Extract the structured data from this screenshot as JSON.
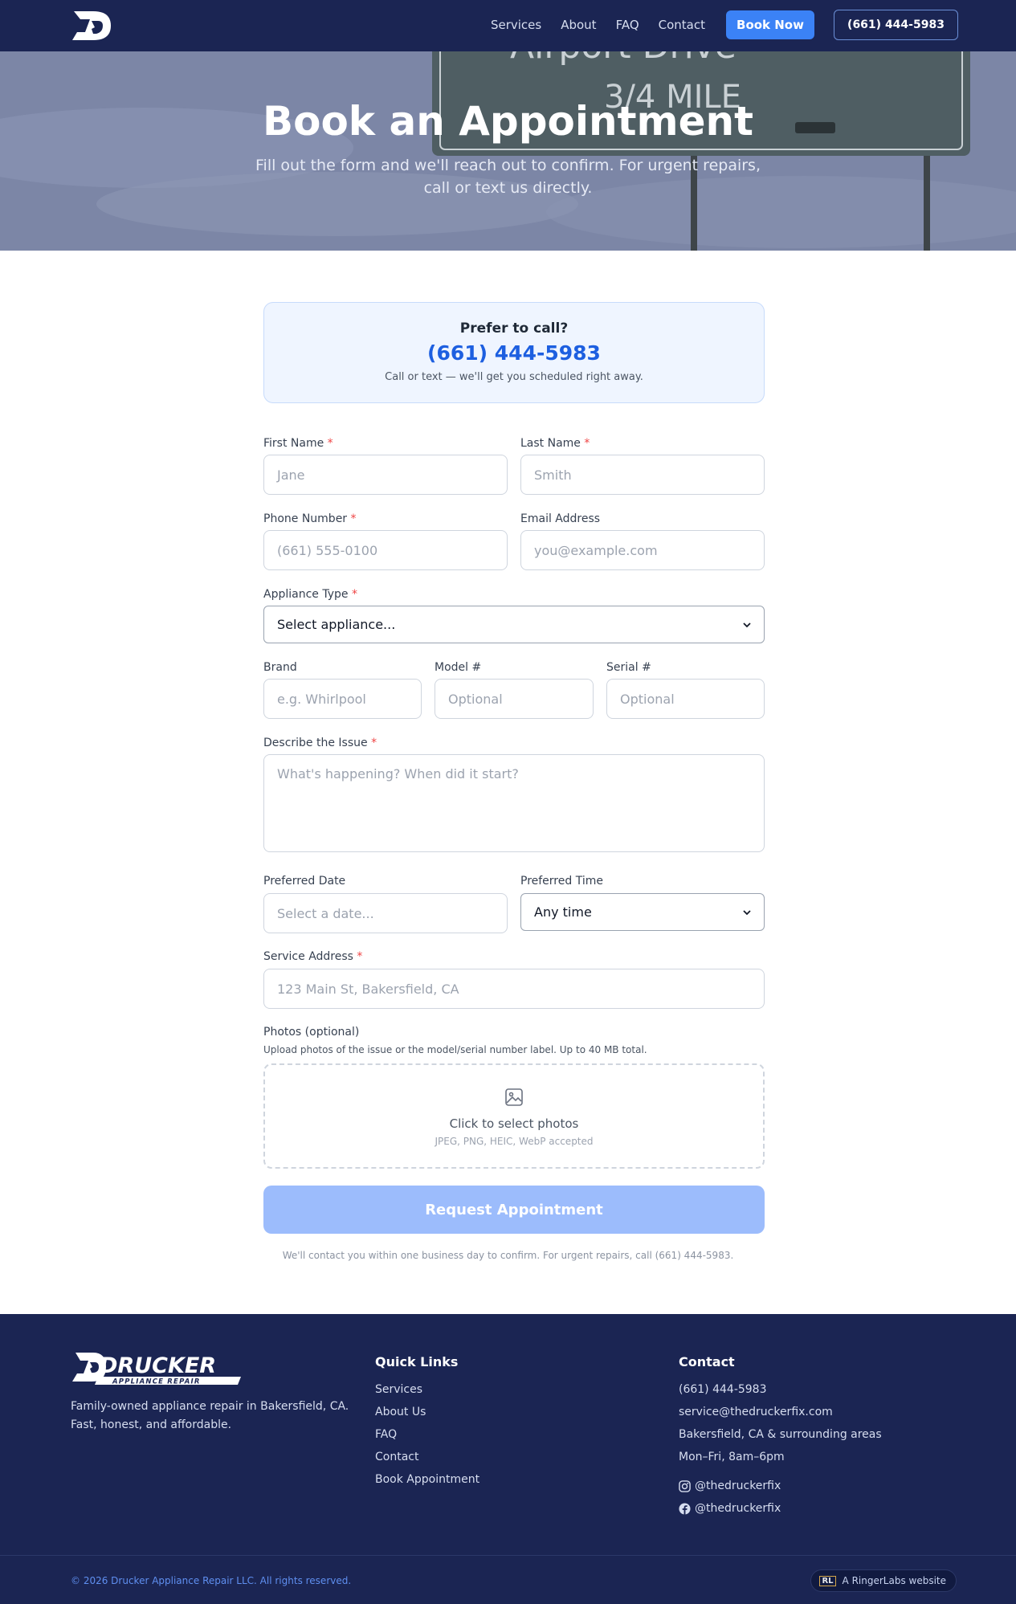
{
  "nav": {
    "links": [
      "Services",
      "About",
      "FAQ",
      "Contact"
    ],
    "book_label": "Book Now",
    "phone_label": "(661) 444-5983"
  },
  "hero": {
    "title": "Book an Appointment",
    "subtitle": "Fill out the form and we'll reach out to confirm. For urgent repairs, call or text us directly."
  },
  "callbox": {
    "title": "Prefer to call?",
    "phone": "(661) 444-5983",
    "note": "Call or text — we'll get you scheduled right away."
  },
  "form": {
    "first_name": {
      "label": "First Name",
      "placeholder": "Jane"
    },
    "last_name": {
      "label": "Last Name",
      "placeholder": "Smith"
    },
    "phone": {
      "label": "Phone Number",
      "placeholder": "(661) 555-0100"
    },
    "email": {
      "label": "Email Address",
      "placeholder": "you@example.com"
    },
    "appliance": {
      "label": "Appliance Type",
      "value": "Select appliance..."
    },
    "brand": {
      "label": "Brand",
      "placeholder": "e.g. Whirlpool"
    },
    "model": {
      "label": "Model #",
      "placeholder": "Optional"
    },
    "serial": {
      "label": "Serial #",
      "placeholder": "Optional"
    },
    "issue": {
      "label": "Describe the Issue",
      "placeholder": "What's happening? When did it start?"
    },
    "date": {
      "label": "Preferred Date",
      "placeholder": "Select a date..."
    },
    "time": {
      "label": "Preferred Time",
      "value": "Any time"
    },
    "address": {
      "label": "Service Address",
      "placeholder": "123 Main St, Bakersfield, CA"
    },
    "photos": {
      "label": "Photos (optional)",
      "helper": "Upload photos of the issue or the model/serial number label. Up to 40 MB total.",
      "drop_label": "Click to select photos",
      "drop_note": "JPEG, PNG, HEIC, WebP accepted"
    },
    "required_mark": "*",
    "submit_label": "Request Appointment",
    "footnote": "We'll contact you within one business day to confirm. For urgent repairs, call (661) 444-5983."
  },
  "footer": {
    "description": "Family-owned appliance repair in Bakersfield, CA. Fast, honest, and affordable.",
    "quick_links_title": "Quick Links",
    "quick_links": [
      "Services",
      "About Us",
      "FAQ",
      "Contact",
      "Book Appointment"
    ],
    "contact_title": "Contact",
    "contact": {
      "phone": "(661) 444-5983",
      "email": "service@thedruckerfix.com",
      "area": "Bakersfield, CA & surrounding areas",
      "hours": "Mon–Fri, 8am–6pm"
    },
    "instagram": "@thedruckerfix",
    "facebook": "@thedruckerfix",
    "copyright": "© 2026 Drucker Appliance Repair LLC. All rights reserved.",
    "ringer_label": "A RingerLabs website",
    "ringer_badge": "RL",
    "logo_text": "DRUCKER",
    "logo_sub": "APPLIANCE REPAIR"
  },
  "hero_sign": {
    "line1": "Airport Drive",
    "line2": "3/4 MILE"
  },
  "colors": {
    "navy": "#1b2553",
    "accent": "#3b82f6",
    "link_blue": "#1d5fe0",
    "required": "#ef4444"
  }
}
